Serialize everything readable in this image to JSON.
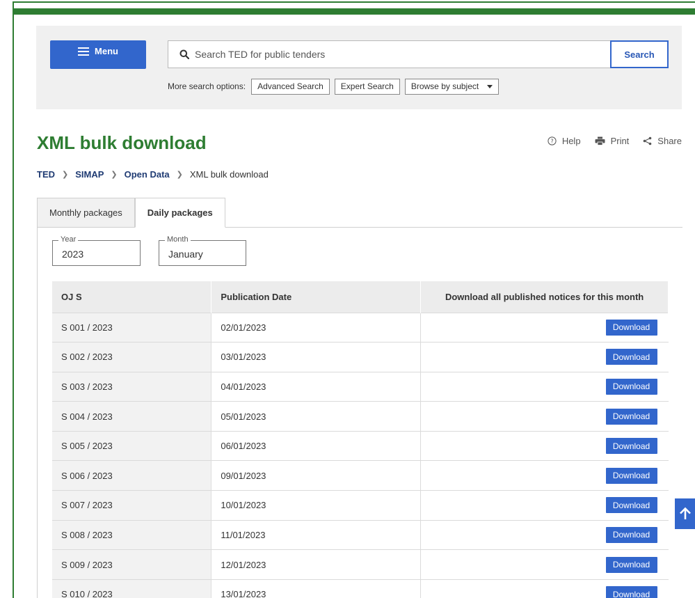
{
  "header": {
    "menu_label": "Menu",
    "search_placeholder": "Search TED for public tenders",
    "search_label": "Search",
    "more_options_label": "More search options:",
    "advanced_search": "Advanced Search",
    "expert_search": "Expert Search",
    "browse_by_subject": "Browse by subject"
  },
  "page": {
    "title": "XML bulk download",
    "actions": {
      "help": "Help",
      "print": "Print",
      "share": "Share"
    },
    "breadcrumb": [
      "TED",
      "SIMAP",
      "Open Data",
      "XML bulk download"
    ]
  },
  "tabs": [
    {
      "label": "Monthly packages",
      "active": false
    },
    {
      "label": "Daily packages",
      "active": true
    }
  ],
  "filters": {
    "year": {
      "legend": "Year",
      "value": "2023"
    },
    "month": {
      "legend": "Month",
      "value": "January"
    }
  },
  "table": {
    "headers": [
      "OJ S",
      "Publication Date",
      "Download all published notices for this month"
    ],
    "download_label": "Download",
    "rows": [
      {
        "ojs": "S 001 / 2023",
        "date": "02/01/2023"
      },
      {
        "ojs": "S 002 / 2023",
        "date": "03/01/2023"
      },
      {
        "ojs": "S 003 / 2023",
        "date": "04/01/2023"
      },
      {
        "ojs": "S 004 / 2023",
        "date": "05/01/2023"
      },
      {
        "ojs": "S 005 / 2023",
        "date": "06/01/2023"
      },
      {
        "ojs": "S 006 / 2023",
        "date": "09/01/2023"
      },
      {
        "ojs": "S 007 / 2023",
        "date": "10/01/2023"
      },
      {
        "ojs": "S 008 / 2023",
        "date": "11/01/2023"
      },
      {
        "ojs": "S 009 / 2023",
        "date": "12/01/2023"
      },
      {
        "ojs": "S 010 / 2023",
        "date": "13/01/2023"
      }
    ]
  },
  "colors": {
    "brand_green": "#2e7d32",
    "primary_blue": "#3266cc"
  }
}
